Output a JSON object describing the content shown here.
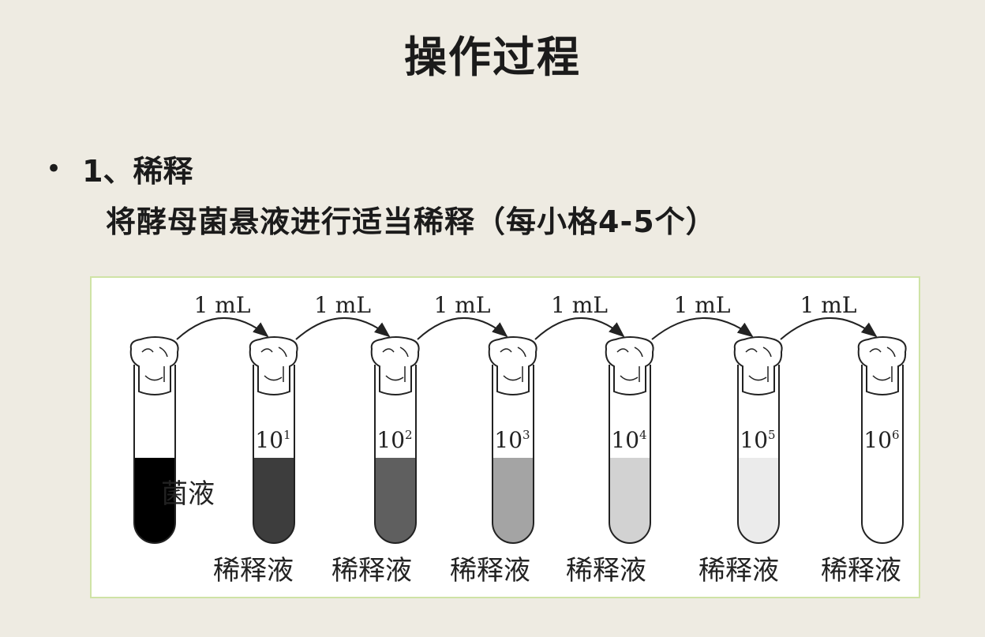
{
  "title": "操作过程",
  "bullet": {
    "heading": "1、稀释",
    "body": "将酵母菌悬液进行适当稀释（每小格4-5个）"
  },
  "diagram": {
    "transfer_label": "1 mL",
    "source_label": "菌液",
    "tube_label": "稀释液",
    "tubes": [
      {
        "base": "",
        "exp": "",
        "fill": "#000000"
      },
      {
        "base": "10",
        "exp": "1",
        "fill": "#3d3d3d"
      },
      {
        "base": "10",
        "exp": "2",
        "fill": "#5f5f5f"
      },
      {
        "base": "10",
        "exp": "3",
        "fill": "#a4a4a4"
      },
      {
        "base": "10",
        "exp": "4",
        "fill": "#d2d2d2"
      },
      {
        "base": "10",
        "exp": "5",
        "fill": "#ebebeb"
      },
      {
        "base": "10",
        "exp": "6",
        "fill": "#ffffff"
      }
    ]
  }
}
